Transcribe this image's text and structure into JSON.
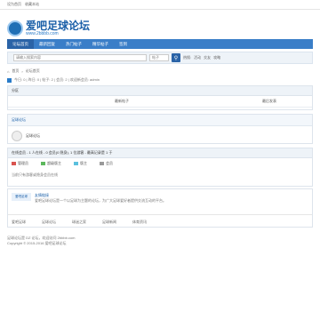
{
  "topbar": {
    "links": [
      "设为首页",
      "收藏本站"
    ]
  },
  "logo": {
    "name": "爱吧足球论坛",
    "url": "www.2bbbb.com"
  },
  "nav": {
    "items": [
      "论坛首页",
      "最新回复",
      "热门帖子",
      "精华帖子",
      "签到"
    ]
  },
  "search": {
    "placeholder": "请输入搜索内容",
    "scope": "帖子",
    "button_icon": "search-icon",
    "hot_label": "热搜:",
    "hot_terms": [
      "活动",
      "交友",
      "攻略"
    ]
  },
  "breadcrumb": [
    "首页",
    "论坛首页"
  ],
  "stats": {
    "text": "今日: 0 | 昨日: 0 | 帖子: 2 | 会员: 2 | 欢迎新会员: admin"
  },
  "category": {
    "title": "分区",
    "col_threads": "最新帖子",
    "col_last": "最后发表"
  },
  "section": {
    "title": "足球论坛",
    "forum_name": "足球论坛"
  },
  "online": {
    "title": "在线会员 - 1 人在线 - 0 会员(0 隐身), 1 位游客 - 最高记录是 1 于 ",
    "legend": [
      "管理员",
      "超级版主",
      "版主",
      "会员"
    ],
    "legend_colors": [
      "#d9534f",
      "#5cb85c",
      "#5bc0de",
      "#999999"
    ],
    "note": "当前只有游客或隐身会员在线"
  },
  "friend": {
    "title": "友情链接",
    "badge": "爱吧足球",
    "desc": "爱吧足球论坛是一个以足球为主题的论坛，为广大足球爱好者提供交流互动的平台。",
    "links": [
      "爱吧足球",
      "足球论坛",
      "球迷之家",
      "足球新闻",
      "体育资讯"
    ]
  },
  "footer": {
    "line1": "足球论坛是 DZ 论坛，欢迎访问 2bbbb.com",
    "line2": "Copyright © 2015-2016 爱吧足球论坛"
  }
}
